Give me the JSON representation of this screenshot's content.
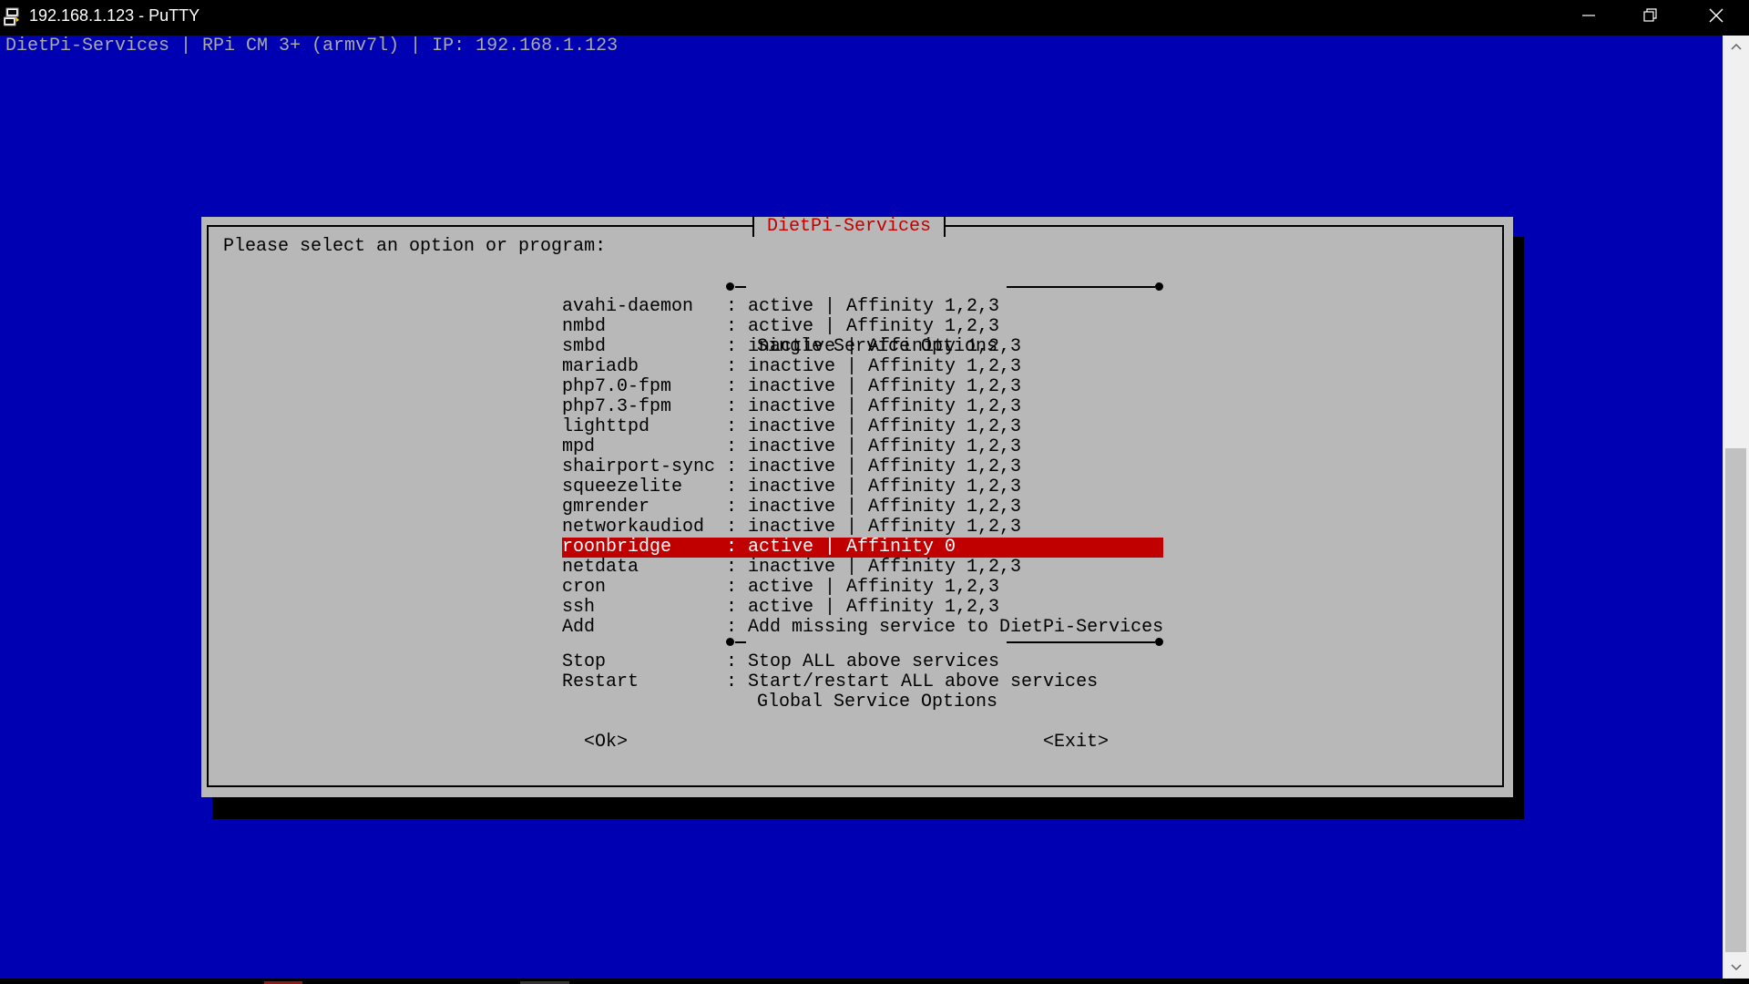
{
  "window": {
    "title": "192.168.1.123 - PuTTY",
    "minimize_icon": "minimize-icon",
    "restore_icon": "restore-icon",
    "close_icon": "close-icon"
  },
  "terminal": {
    "header": "DietPi-Services | RPi CM 3+ (armv7l) | IP: 192.168.1.123",
    "background": "#0000b3"
  },
  "dialog": {
    "title": "DietPi-Services",
    "prompt": "Please select an option or program:",
    "section_single": "Single Service Options",
    "section_global": "Global Service Options",
    "items": [
      {
        "name": "avahi-daemon",
        "desc": ": active | Affinity 1,2,3"
      },
      {
        "name": "nmbd",
        "desc": ": active | Affinity 1,2,3"
      },
      {
        "name": "smbd",
        "desc": ": inactive | Affinity 1,2,3"
      },
      {
        "name": "mariadb",
        "desc": ": inactive | Affinity 1,2,3"
      },
      {
        "name": "php7.0-fpm",
        "desc": ": inactive | Affinity 1,2,3"
      },
      {
        "name": "php7.3-fpm",
        "desc": ": inactive | Affinity 1,2,3"
      },
      {
        "name": "lighttpd",
        "desc": ": inactive | Affinity 1,2,3"
      },
      {
        "name": "mpd",
        "desc": ": inactive | Affinity 1,2,3"
      },
      {
        "name": "shairport-sync",
        "desc": ": inactive | Affinity 1,2,3"
      },
      {
        "name": "squeezelite",
        "desc": ": inactive | Affinity 1,2,3"
      },
      {
        "name": "gmrender",
        "desc": ": inactive | Affinity 1,2,3"
      },
      {
        "name": "networkaudiod",
        "desc": ": inactive | Affinity 1,2,3"
      },
      {
        "name": "roonbridge",
        "desc": ": active | Affinity 0"
      },
      {
        "name": "netdata",
        "desc": ": inactive | Affinity 1,2,3"
      },
      {
        "name": "cron",
        "desc": ": active | Affinity 1,2,3"
      },
      {
        "name": "ssh",
        "desc": ": active | Affinity 1,2,3"
      },
      {
        "name": "Add",
        "desc": ": Add missing service to DietPi-Services"
      }
    ],
    "global_items": [
      {
        "name": "Stop",
        "desc": ": Stop ALL above services"
      },
      {
        "name": "Restart",
        "desc": ": Start/restart ALL above services"
      }
    ],
    "selected": "roonbridge",
    "ok_label": "<Ok>",
    "exit_label": "<Exit>"
  },
  "colors": {
    "highlight": "#c00000",
    "dialog_bg": "#b8b8b8"
  }
}
